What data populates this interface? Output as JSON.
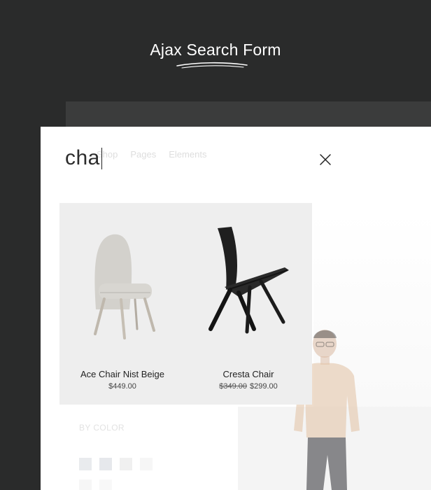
{
  "header": {
    "title": "Ajax Search Form"
  },
  "background_page": {
    "menu": [
      "Shop",
      "Pages",
      "Elements"
    ],
    "filter_heading": "BY COLOR",
    "swatch_colors": [
      "#e9ebee",
      "#e6e8ec",
      "#f0f0f0",
      "#f6f6f6"
    ]
  },
  "search": {
    "query": "cha"
  },
  "results": [
    {
      "name": "Ace Chair Nist Beige",
      "price": "$449.00",
      "old_price": "",
      "icon": "beige-chair-image"
    },
    {
      "name": "Cresta Chair",
      "price": "$299.00",
      "old_price": "$349.00",
      "icon": "black-chair-image"
    }
  ],
  "colors": {
    "page_bg": "#2a2b2b",
    "panel_bg": "#ffffff",
    "results_bg": "#eeeeee"
  }
}
